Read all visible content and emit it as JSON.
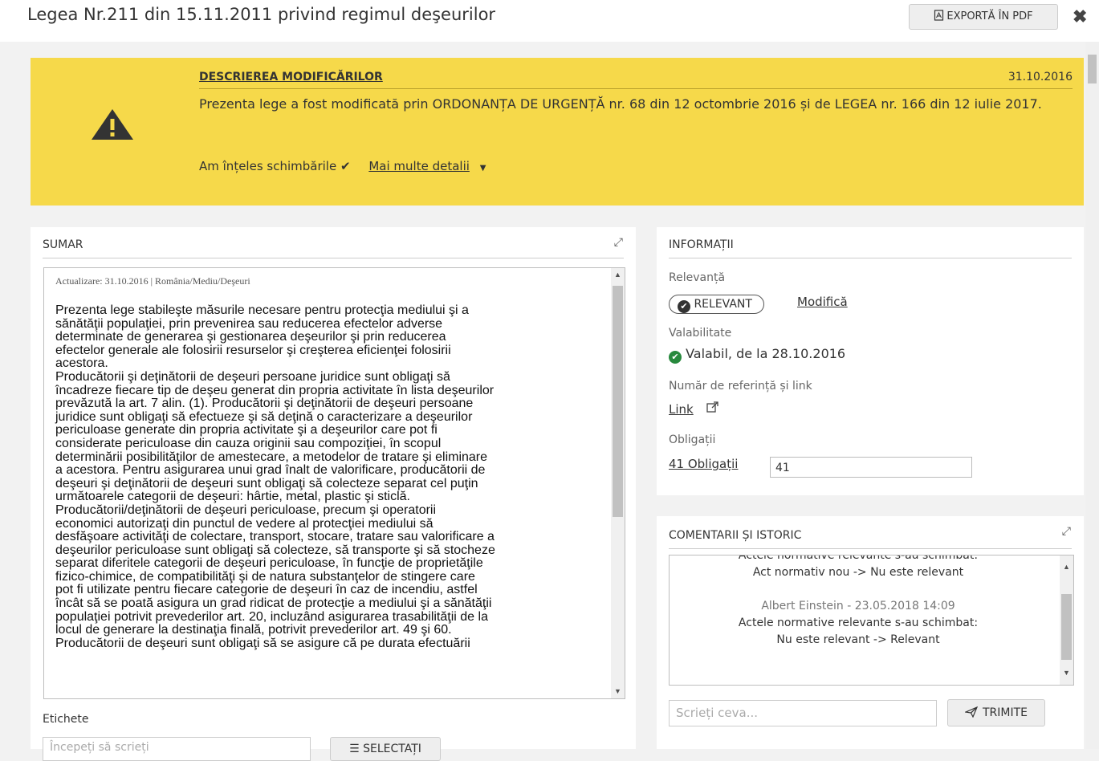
{
  "header": {
    "title": "Legea Nr.211 din 15.11.2011 privind regimul deşeurilor",
    "export_label": "EXPORTĂ ÎN PDF"
  },
  "notice": {
    "label": "DESCRIEREA MODIFICĂRILOR",
    "date": "31.10.2016",
    "text": "Prezenta lege a fost modificată prin ORDONANȚA DE URGENȚĂ nr. 68 din 12 octombrie 2016 și de LEGEA nr. 166 din 12 iulie 2017.",
    "understood_label": "Am înțeles schimbările",
    "details_label": "Mai multe detalii"
  },
  "sumar": {
    "title": "SUMAR",
    "meta": "Actualizare: 31.10.2016 | România/Mediu/Deşeuri",
    "lines": [
      "Prezenta lege stabileşte măsurile necesare pentru protecţia mediului şi a",
      "sănătăţii populaţiei, prin prevenirea sau reducerea efectelor adverse",
      "determinate de generarea şi gestionarea deşeurilor şi prin reducerea",
      "efectelor generale ale folosirii resurselor şi creşterea eficienţei folosirii",
      "acestora.",
      "Producătorii şi deţinătorii de deşeuri persoane juridice sunt obligaţi să",
      "încadreze fiecare tip de deşeu generat din propria activitate în lista deşeurilor",
      "prevăzută la art. 7 alin. (1). Producătorii şi deţinătorii de deşeuri persoane",
      "juridice sunt obligaţi să efectueze şi să deţină o caracterizare a deşeurilor",
      "periculoase generate din propria activitate şi a deşeurilor care pot fi",
      "considerate periculoase din cauza originii sau compoziţiei, în scopul",
      "determinării posibilităţilor de amestecare, a metodelor de tratare şi eliminare",
      "a acestora. Pentru asigurarea unui grad înalt de valorificare, producătorii de",
      "deşeuri şi deţinătorii de deşeuri sunt obligaţi să colecteze separat cel puţin",
      "următoarele categorii de deşeuri: hârtie, metal, plastic şi sticlă.",
      "Producătorii/deţinătorii de deşeuri periculoase, precum şi operatorii",
      "economici autorizaţi din punctul de vedere al protecţiei mediului să",
      "desfăşoare activităţi de colectare, transport, stocare, tratare sau valorificare a",
      "deşeurilor periculoase sunt obligaţi să colecteze, să transporte şi să stocheze",
      "separat diferitele categorii de deşeuri periculoase, în funcţie de proprietăţile",
      "fizico-chimice, de compatibilităţi şi de natura substanţelor de stingere care",
      "pot fi utilizate pentru fiecare categorie de deşeuri în caz de incendiu, astfel",
      "încât să se poată asigura un grad ridicat de protecţie a mediului şi a sănătăţii",
      "populaţiei potrivit prevederilor art. 20, incluzând asigurarea trasabilităţii de la",
      "locul de generare la destinaţia finală, potrivit prevederilor art. 49 şi 60.",
      "Producătorii de deşeuri sunt obligaţi să se asigure că pe durata efectuării"
    ]
  },
  "tags": {
    "label": "Etichete",
    "placeholder": "Începeți să scrieți",
    "select_label": "SELECTAȚI"
  },
  "info": {
    "title": "INFORMAȚII",
    "relevance_label": "Relevanță",
    "relevance_value": "RELEVANT",
    "modify_label": "Modifică",
    "validity_label": "Valabilitate",
    "validity_value": "Valabil, de la 28.10.2016",
    "ref_label": "Număr de referință și link",
    "link_label": "Link",
    "obligations_label": "Obligații",
    "obligations_link": "41 Obligații",
    "obligations_value": "41"
  },
  "comments": {
    "title": "COMENTARII ȘI ISTORIC",
    "lines": [
      "Actele normative relevante s-au schimbat:",
      "Act normativ nou -> Nu este relevant",
      "",
      "Albert Einstein - 23.05.2018 14:09",
      "Actele normative relevante s-au schimbat:",
      "Nu este relevant -> Relevant"
    ],
    "input_placeholder": "Scrieți ceva...",
    "send_label": "TRIMITE"
  },
  "icons": [
    "pdf-icon",
    "close-icon",
    "warning-icon",
    "check-icon",
    "chevron-down-icon",
    "expand-icon",
    "external-link-icon",
    "paper-plane-icon",
    "list-icon"
  ],
  "colors": {
    "notice_bg": "#f6d94a",
    "valid_green": "#27893d"
  }
}
